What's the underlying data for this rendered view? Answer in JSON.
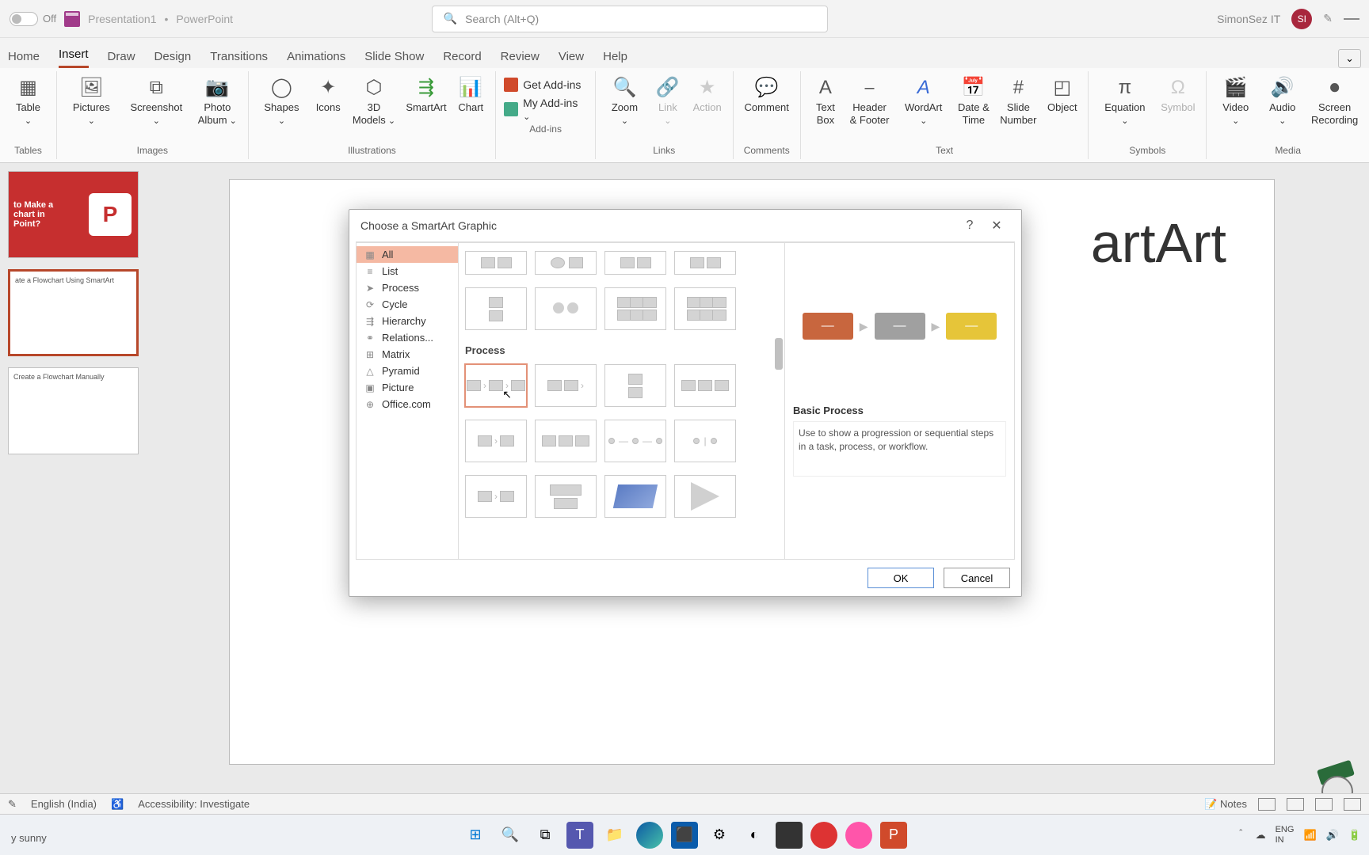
{
  "titlebar": {
    "autosave_label": "Off",
    "doc_name": "Presentation1",
    "app_name": "PowerPoint",
    "search_placeholder": "Search (Alt+Q)",
    "user_name": "SimonSez IT",
    "user_initials": "SI"
  },
  "tabs": {
    "items": [
      "Home",
      "Insert",
      "Draw",
      "Design",
      "Transitions",
      "Animations",
      "Slide Show",
      "Record",
      "Review",
      "View",
      "Help"
    ],
    "active_index": 1,
    "collapse": "⌄"
  },
  "ribbon": {
    "groups": [
      {
        "label": "Tables",
        "buttons": [
          {
            "label": "Table",
            "chev": true
          }
        ]
      },
      {
        "label": "Images",
        "buttons": [
          {
            "label": "Pictures",
            "chev": true
          },
          {
            "label": "Screenshot",
            "chev": true
          },
          {
            "label": "Photo\nAlbum",
            "chev": true
          }
        ]
      },
      {
        "label": "Illustrations",
        "buttons": [
          {
            "label": "Shapes",
            "chev": true
          },
          {
            "label": "Icons"
          },
          {
            "label": "3D\nModels",
            "chev": true
          },
          {
            "label": "SmartArt"
          },
          {
            "label": "Chart"
          }
        ]
      },
      {
        "label": "Add-ins",
        "rows": [
          {
            "label": "Get Add-ins"
          },
          {
            "label": "My Add-ins",
            "chev": true
          }
        ]
      },
      {
        "label": "Links",
        "buttons": [
          {
            "label": "Zoom",
            "chev": true
          },
          {
            "label": "Link",
            "chev": true,
            "disabled": true
          },
          {
            "label": "Action",
            "disabled": true
          }
        ]
      },
      {
        "label": "Comments",
        "buttons": [
          {
            "label": "Comment"
          }
        ]
      },
      {
        "label": "Text",
        "buttons": [
          {
            "label": "Text\nBox"
          },
          {
            "label": "Header\n& Footer"
          },
          {
            "label": "WordArt",
            "chev": true
          },
          {
            "label": "Date &\nTime"
          },
          {
            "label": "Slide\nNumber"
          },
          {
            "label": "Object"
          }
        ]
      },
      {
        "label": "Symbols",
        "buttons": [
          {
            "label": "Equation",
            "chev": true
          },
          {
            "label": "Symbol",
            "disabled": true
          }
        ]
      },
      {
        "label": "Media",
        "buttons": [
          {
            "label": "Video",
            "chev": true
          },
          {
            "label": "Audio",
            "chev": true
          },
          {
            "label": "Screen\nRecording"
          }
        ]
      }
    ]
  },
  "thumbs": {
    "slide1_text": "to Make a\nchart in\nPoint?",
    "slide1_logo": "P",
    "slide2_text": "ate a Flowchart Using SmartArt",
    "slide3_text": "Create a Flowchart Manually"
  },
  "slide": {
    "title_fragment": "artArt"
  },
  "dialog": {
    "title": "Choose a SmartArt Graphic",
    "help": "?",
    "close": "✕",
    "categories": [
      {
        "label": "All",
        "selected": true
      },
      {
        "label": "List"
      },
      {
        "label": "Process"
      },
      {
        "label": "Cycle"
      },
      {
        "label": "Hierarchy"
      },
      {
        "label": "Relations..."
      },
      {
        "label": "Matrix"
      },
      {
        "label": "Pyramid"
      },
      {
        "label": "Picture"
      },
      {
        "label": "Office.com"
      }
    ],
    "section_label": "Process",
    "preview_name": "Basic Process",
    "preview_desc": "Use to show a progression or sequential steps in a task, process, or workflow.",
    "preview_colors": [
      "#c8663e",
      "#a0a0a0",
      "#e6c539"
    ],
    "ok": "OK",
    "cancel": "Cancel"
  },
  "statusbar": {
    "lang": "English (India)",
    "access": "Accessibility: Investigate",
    "notes": "Notes"
  },
  "taskbar": {
    "weather": "y sunny",
    "lang": "ENG\nIN",
    "icons": [
      "start",
      "search",
      "taskview",
      "teams",
      "files",
      "edge",
      "store",
      "widgets",
      "chrome",
      "app1",
      "app2",
      "app3",
      "powerpoint"
    ]
  }
}
